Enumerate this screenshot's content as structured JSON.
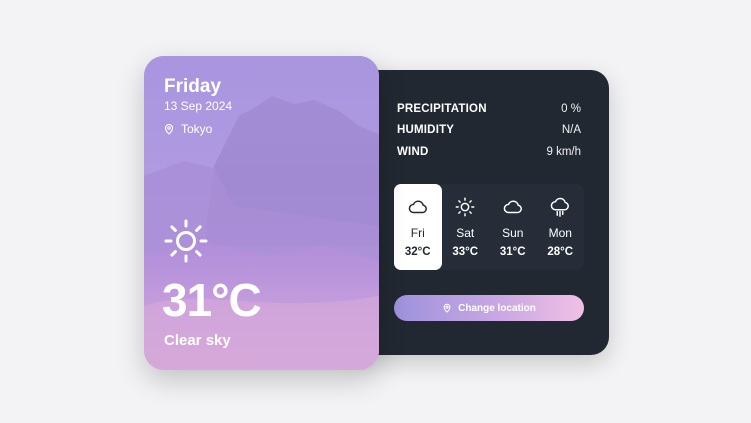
{
  "card": {
    "day": "Friday",
    "date": "13 Sep 2024",
    "location": "Tokyo",
    "location_icon": "location-pin-icon",
    "current_icon": "sun-icon",
    "temperature": "31°C",
    "condition": "Clear sky"
  },
  "stats": [
    {
      "label": "PRECIPITATION",
      "value": "0 %"
    },
    {
      "label": "HUMIDITY",
      "value": "N/A"
    },
    {
      "label": "WIND",
      "value": "9 km/h"
    }
  ],
  "forecast": [
    {
      "day": "Fri",
      "temp": "32°C",
      "icon": "cloud-icon",
      "selected": true
    },
    {
      "day": "Sat",
      "temp": "33°C",
      "icon": "sun-icon",
      "selected": false
    },
    {
      "day": "Sun",
      "temp": "31°C",
      "icon": "cloud-icon",
      "selected": false
    },
    {
      "day": "Mon",
      "temp": "28°C",
      "icon": "cloud-rain-icon",
      "selected": false
    }
  ],
  "change_location": {
    "label": "Change location",
    "icon": "location-pin-icon"
  },
  "colors": {
    "panel": "#222831",
    "card_tint": "#a392d9",
    "button_gradient_start": "#9d92dc",
    "button_gradient_end": "#f0c1e4"
  }
}
